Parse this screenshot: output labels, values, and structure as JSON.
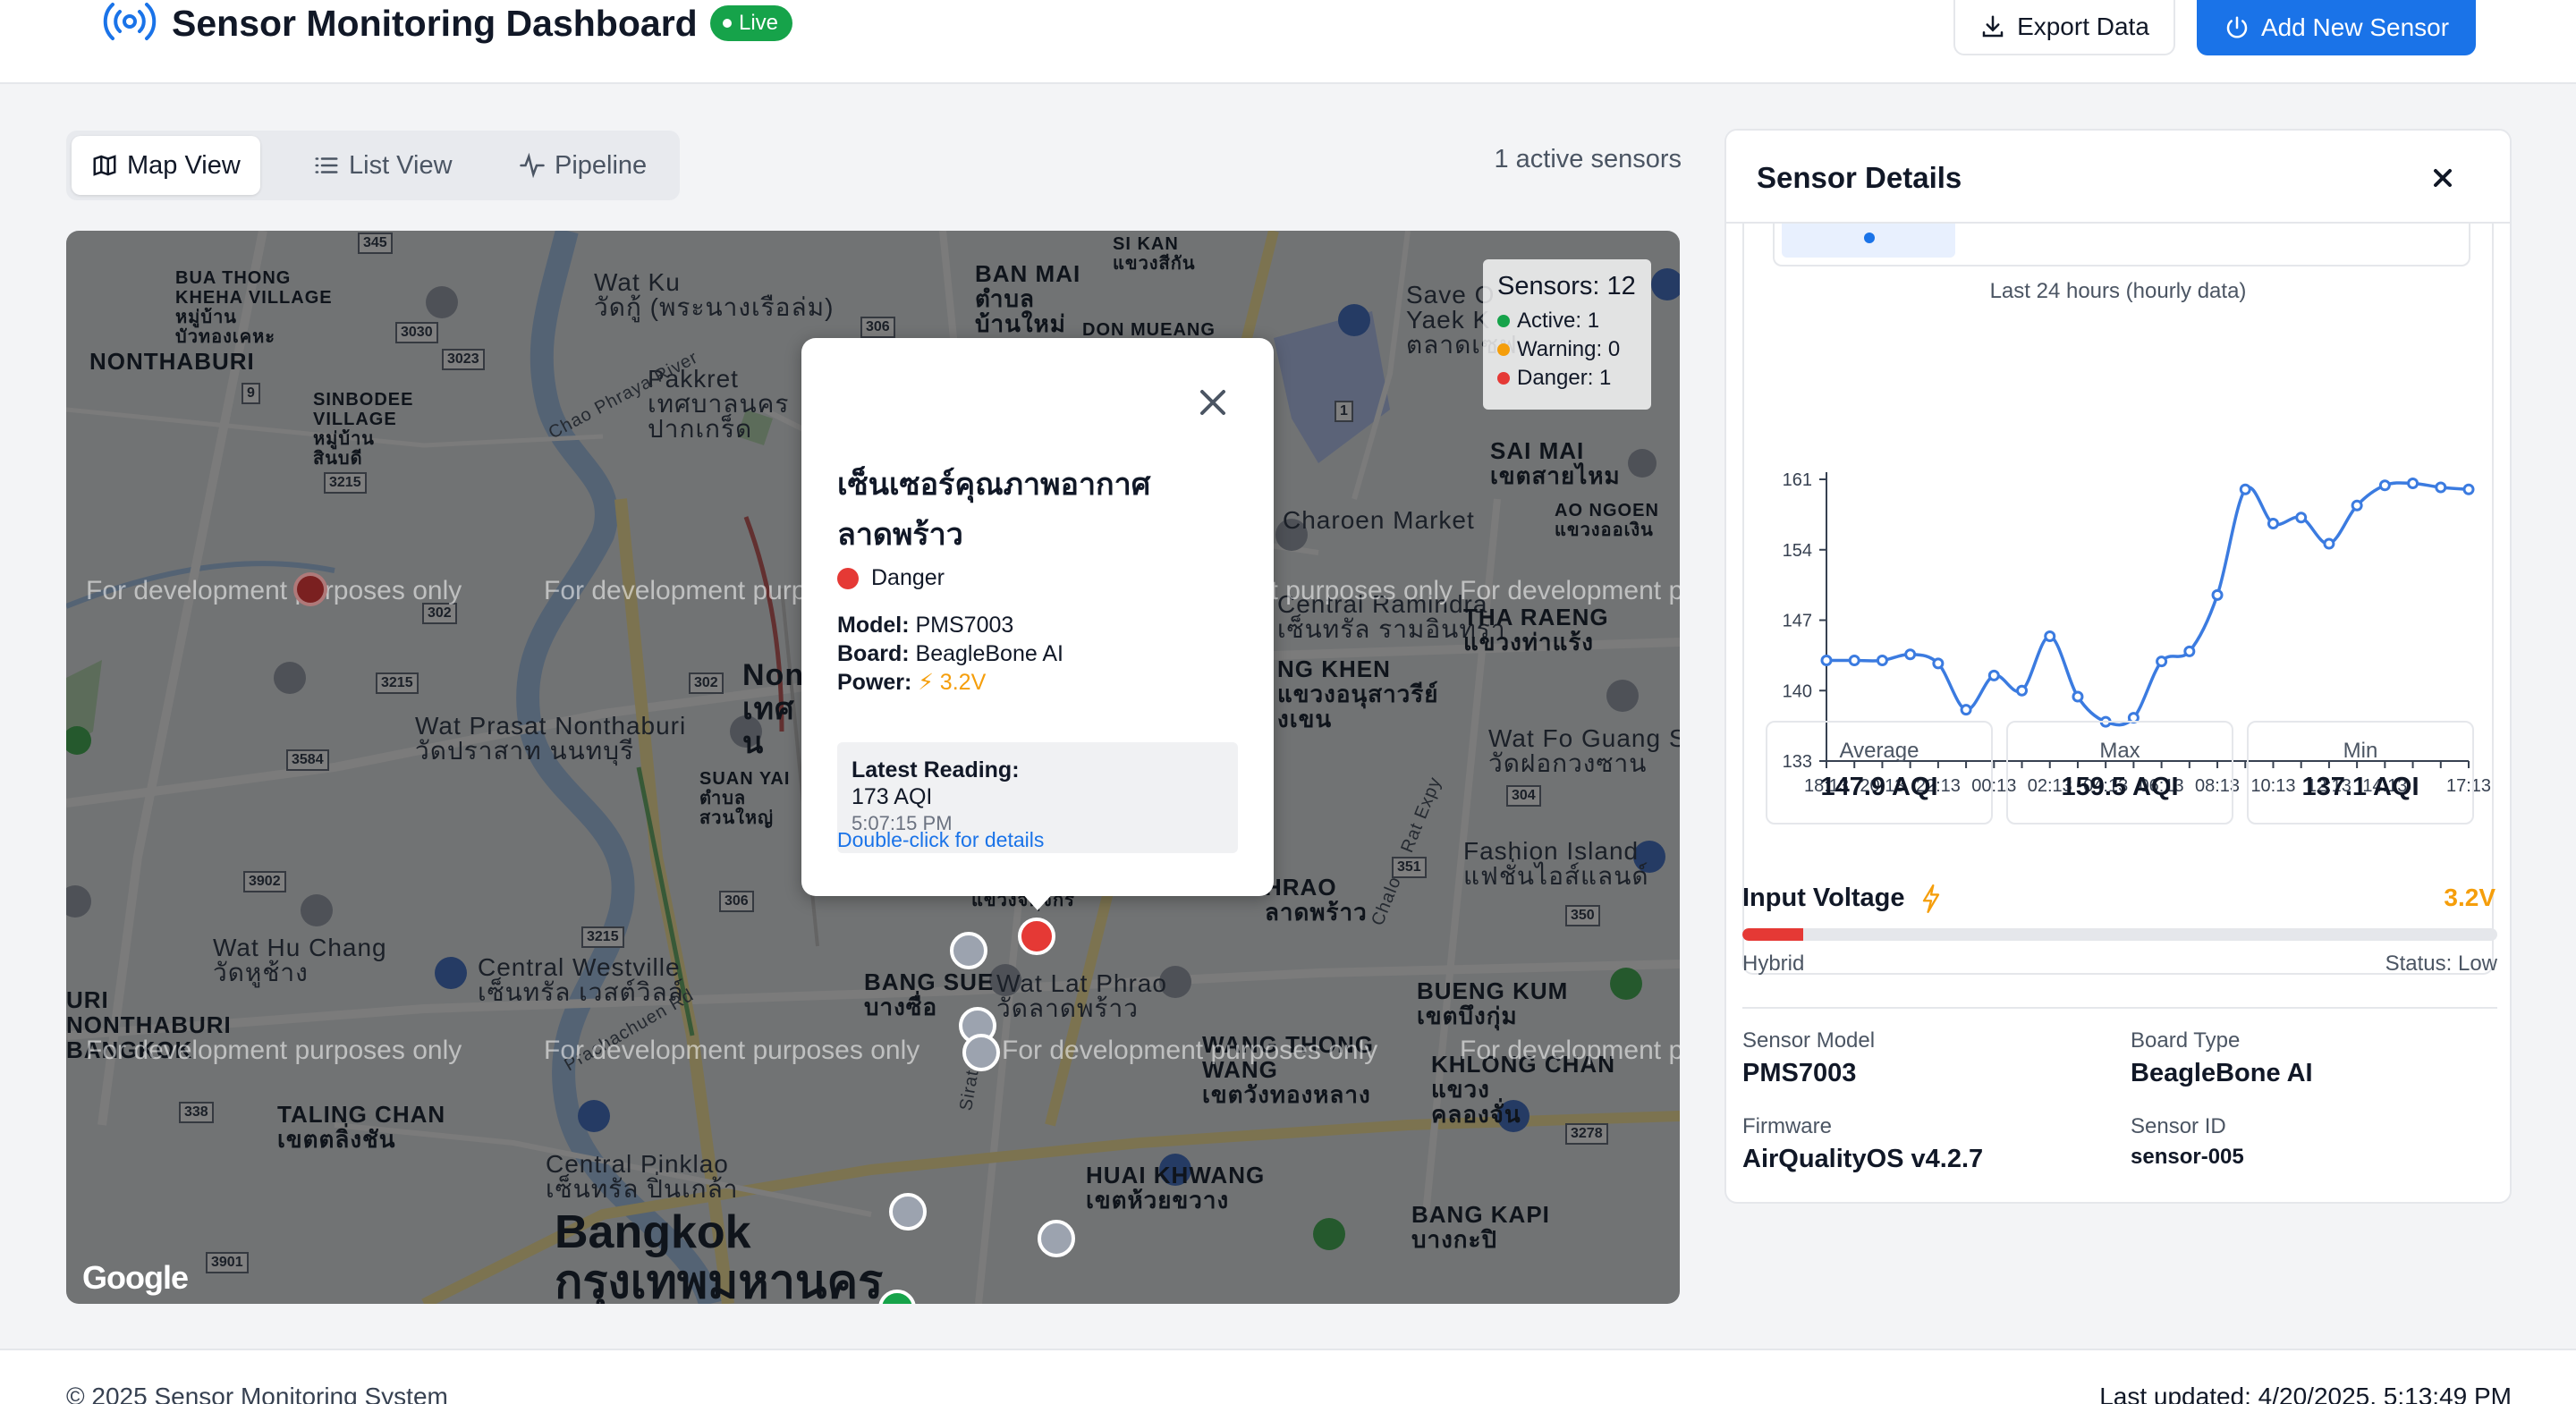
{
  "header": {
    "title": "Sensor Monitoring Dashboard",
    "live_badge": "Live",
    "export_label": "Export Data",
    "add_label": "Add New Sensor"
  },
  "views": {
    "tabs": [
      {
        "label": "Map View",
        "icon": "map-icon",
        "active": true
      },
      {
        "label": "List View",
        "icon": "list-icon",
        "active": false
      },
      {
        "label": "Pipeline",
        "icon": "activity-icon",
        "active": false
      }
    ],
    "active_sensors": "1 active sensors"
  },
  "map": {
    "attribution": "Google",
    "dev_watermark": "For development purposes only",
    "legend": {
      "title": "Sensors: 12",
      "active": "Active: 1",
      "warning": "Warning: 0",
      "danger": "Danger: 1",
      "colors": {
        "active": "#16a34a",
        "warning": "#f59e0b",
        "danger": "#e53935"
      }
    },
    "places": {
      "bua_thong": "BUA THONG\nKHEHA VILLAGE\nหมู่บ้าน\nบัวทองเคหะ",
      "nonthaburi": "NONTHABURI",
      "sinbodee": "SINBODEE\nVILLAGE\nหมู่บ้าน\nสินบดี",
      "wat_ku": "Wat Ku\nวัดกู้ (พระนางเรือล่ม)",
      "pakkret": "Pakkret\nเทศบาลนคร\nปากเกร็ด",
      "si_kan": "SI KAN\nแขวงสีกัน",
      "ban_mai": "BAN MAI\nตำบล\nบ้านใหม่",
      "don_mueang": "DON MUEANG",
      "save_one": "Save O\nYaek K\nตลาดเซฟ",
      "sai_mai": "SAI MAI\nเขตสายไหม",
      "ao_ngoen": "AO NGOEN\nแขวงออเงิน",
      "charoen_market": "Charoen Market",
      "central_ramindra": "Central Ramindra\nเซ็นทรัล รามอินทรา",
      "tha_raeng": "THA RAENG\nแขวงท่าแร้ง",
      "anusawari": "NG KHEN\nแขวงอนุสาวรีย์\nงเขน",
      "wat_prasat": "Wat Prasat Nonthaburi\nวัดปราสาท นนทบุรี",
      "suan_yai": "SUAN YAI\nตำบล\nสวนใหญ่",
      "non": "Non\nเทศ\nน",
      "wat_fo_guang": "Wat Fo Guang Sa\nวัดฝอกวงซาน",
      "fashion_island": "Fashion Island\nแฟชั่นไอส์แลนด์",
      "chatuchak": "แขวงจตุจักร",
      "ladprao": "HRAO\nลาดพร้าว",
      "wat_hu_chang": "Wat Hu Chang\nวัดหูช้าง",
      "central_westville": "Central Westville\nเซ็นทรัล เวสต์วิลล์",
      "nonthaburi_bangkok": "URI\nNONTHABURI\nBANGKOK",
      "bang_sue": "BANG SUE\nบางซื่อ",
      "wat_lat_phrao": "Wat Lat Phrao\nวัดลาดพร้าว",
      "bueng_kum": "BUENG KUM\nเขตบึงกุ่ม",
      "wang_thonglang": "WANG THONG\nWANG\nเขตวังทองหลาง",
      "khlong_chan": "KHLONG CHAN\nแขวง\nคลองจั่น",
      "taling_chan": "TALING CHAN\nเขตตลิ่งชัน",
      "central_pinklao": "Central Pinklao\nเซ็นทรัล ปิ่นเกล้า",
      "huai_khwang": "HUAI KHWANG\nเขตห้วยขวาง",
      "bang_kapi": "BANG KAPI\nบางกะปิ",
      "bangkok": "Bangkok\nกรุงเทพมหานคร",
      "chao_phraya_river": "Chao Phraya River",
      "sirat_expy": "Sirat Expy",
      "chalong_rat": "Chalong Rat Expy",
      "prachachuen": "Prachachuen Rd"
    },
    "routes": [
      "345",
      "306",
      "3030",
      "3023",
      "3215",
      "302",
      "3215",
      "302",
      "3584",
      "3902",
      "306",
      "3215",
      "338",
      "3901",
      "3278",
      "350",
      "351",
      "304",
      "1",
      "9"
    ]
  },
  "popup": {
    "title": "เซ็นเซอร์คุณภาพอากาศ ลาดพร้าว",
    "status": "Danger",
    "model_label": "Model:",
    "model": "PMS7003",
    "board_label": "Board:",
    "board": "BeagleBone AI",
    "power_label": "Power:",
    "power": "⚡ 3.2V",
    "reading_label": "Latest Reading:",
    "reading_value": "173 AQI",
    "reading_time": "5:07:15 PM",
    "hint": "Double-click for details"
  },
  "details": {
    "title": "Sensor Details",
    "chart_subtitle": "Last 24 hours (hourly data)",
    "stats": [
      {
        "label": "Average",
        "value": "147.9 AQI"
      },
      {
        "label": "Max",
        "value": "159.5 AQI"
      },
      {
        "label": "Min",
        "value": "137.1 AQI"
      }
    ],
    "input_voltage_label": "Input Voltage",
    "input_voltage_value": "3.2V",
    "voltage_level_fraction": 0.08,
    "source": "Hybrid",
    "status": "Status: Low",
    "sensor_model_label": "Sensor Model",
    "sensor_model": "PMS7003",
    "board_type_label": "Board Type",
    "board_type": "BeagleBone AI",
    "firmware_label": "Firmware",
    "firmware": "AirQualityOS v4.2.7",
    "sensor_id_label": "Sensor ID",
    "sensor_id": "sensor-005"
  },
  "chart_data": {
    "type": "line",
    "x_tick_labels": [
      "18:13",
      "20:13",
      "22:13",
      "00:13",
      "02:13",
      "04:13",
      "06:13",
      "08:13",
      "10:13",
      "12:13",
      "14:13",
      "17:13"
    ],
    "y_ticks": [
      133,
      140,
      147,
      154,
      161
    ],
    "ylim": [
      133,
      161
    ],
    "grid": false,
    "series": [
      {
        "color": "#3b7be0",
        "values": [
          143.0,
          143.0,
          143.0,
          143.6,
          142.7,
          138.1,
          141.5,
          140.0,
          145.4,
          139.4,
          136.9,
          137.3,
          142.9,
          143.9,
          149.5,
          160.0,
          156.6,
          157.2,
          154.6,
          158.4,
          160.4,
          160.6,
          160.2,
          160.0
        ]
      }
    ]
  },
  "footer": {
    "copyright": "© 2025 Sensor Monitoring System",
    "updated": "Last updated: 4/20/2025, 5:13:49 PM"
  }
}
